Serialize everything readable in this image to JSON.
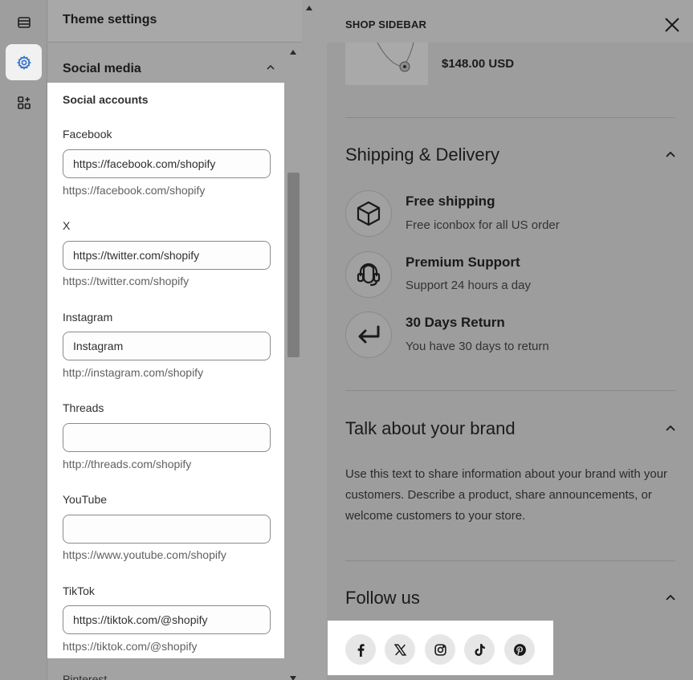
{
  "panel": {
    "title": "Theme settings",
    "section_title": "Social media",
    "subheading": "Social accounts",
    "fields": [
      {
        "label": "Facebook",
        "value": "https://facebook.com/shopify",
        "placeholder": "",
        "help": "https://facebook.com/shopify"
      },
      {
        "label": "X",
        "value": "https://twitter.com/shopify",
        "placeholder": "",
        "help": "https://twitter.com/shopify"
      },
      {
        "label": "Instagram",
        "value": "Instagram",
        "placeholder": "",
        "help": "http://instagram.com/shopify"
      },
      {
        "label": "Threads",
        "value": "",
        "placeholder": "",
        "help": "http://threads.com/shopify"
      },
      {
        "label": "YouTube",
        "value": "",
        "placeholder": "",
        "help": "https://www.youtube.com/shopify"
      },
      {
        "label": "TikTok",
        "value": "https://tiktok.com/@shopify",
        "placeholder": "",
        "help": "https://tiktok.com/@shopify"
      }
    ],
    "next_field_label": "Pinterest"
  },
  "rail": {
    "icons": [
      "sections-icon",
      "settings-gear-icon",
      "apps-icon"
    ],
    "active": "settings-gear-icon"
  },
  "preview": {
    "sidebar_title": "SHOP SIDEBAR",
    "price": "$148.00 USD",
    "shipping": {
      "title": "Shipping & Delivery",
      "features": [
        {
          "icon": "box-icon",
          "title": "Free shipping",
          "subtitle": "Free iconbox for all US order"
        },
        {
          "icon": "headset-icon",
          "title": "Premium Support",
          "subtitle": "Support 24 hours a day"
        },
        {
          "icon": "return-arrow-icon",
          "title": "30 Days Return",
          "subtitle": "You have 30 days to return"
        }
      ]
    },
    "brand": {
      "title": "Talk about your brand",
      "text": "Use this text to share information about your brand with your customers. Describe a product, share announcements, or welcome customers to your store."
    },
    "follow": {
      "title": "Follow us",
      "icons": [
        "facebook-icon",
        "x-icon",
        "instagram-icon",
        "tiktok-icon",
        "pinterest-icon"
      ]
    }
  }
}
